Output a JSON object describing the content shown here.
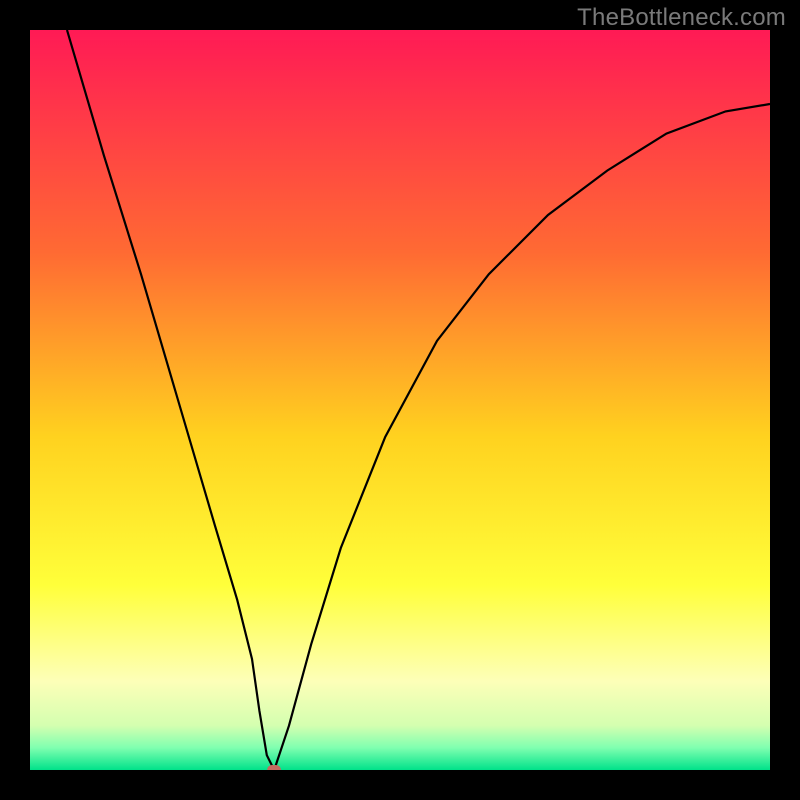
{
  "watermark": {
    "text": "TheBottleneck.com"
  },
  "chart_data": {
    "type": "line",
    "title": "",
    "xlabel": "",
    "ylabel": "",
    "xlim": [
      0,
      100
    ],
    "ylim": [
      0,
      100
    ],
    "grid": false,
    "legend": false,
    "series": [
      {
        "name": "curve",
        "x": [
          5,
          10,
          15,
          20,
          25,
          28,
          30,
          31,
          32,
          33,
          35,
          38,
          42,
          48,
          55,
          62,
          70,
          78,
          86,
          94,
          100
        ],
        "y": [
          100,
          83,
          67,
          50,
          33,
          23,
          15,
          8,
          2,
          0,
          6,
          17,
          30,
          45,
          58,
          67,
          75,
          81,
          86,
          89,
          90
        ]
      }
    ],
    "marker": {
      "x": 33,
      "y": 0,
      "color": "#c46a5f"
    },
    "background_gradient": [
      {
        "stop": 0.0,
        "color": "#ff1a55"
      },
      {
        "stop": 0.3,
        "color": "#ff6a33"
      },
      {
        "stop": 0.55,
        "color": "#ffd21f"
      },
      {
        "stop": 0.75,
        "color": "#ffff3a"
      },
      {
        "stop": 0.88,
        "color": "#fdffb8"
      },
      {
        "stop": 0.94,
        "color": "#d4ffb0"
      },
      {
        "stop": 0.97,
        "color": "#7fffb0"
      },
      {
        "stop": 1.0,
        "color": "#00e28a"
      }
    ]
  }
}
